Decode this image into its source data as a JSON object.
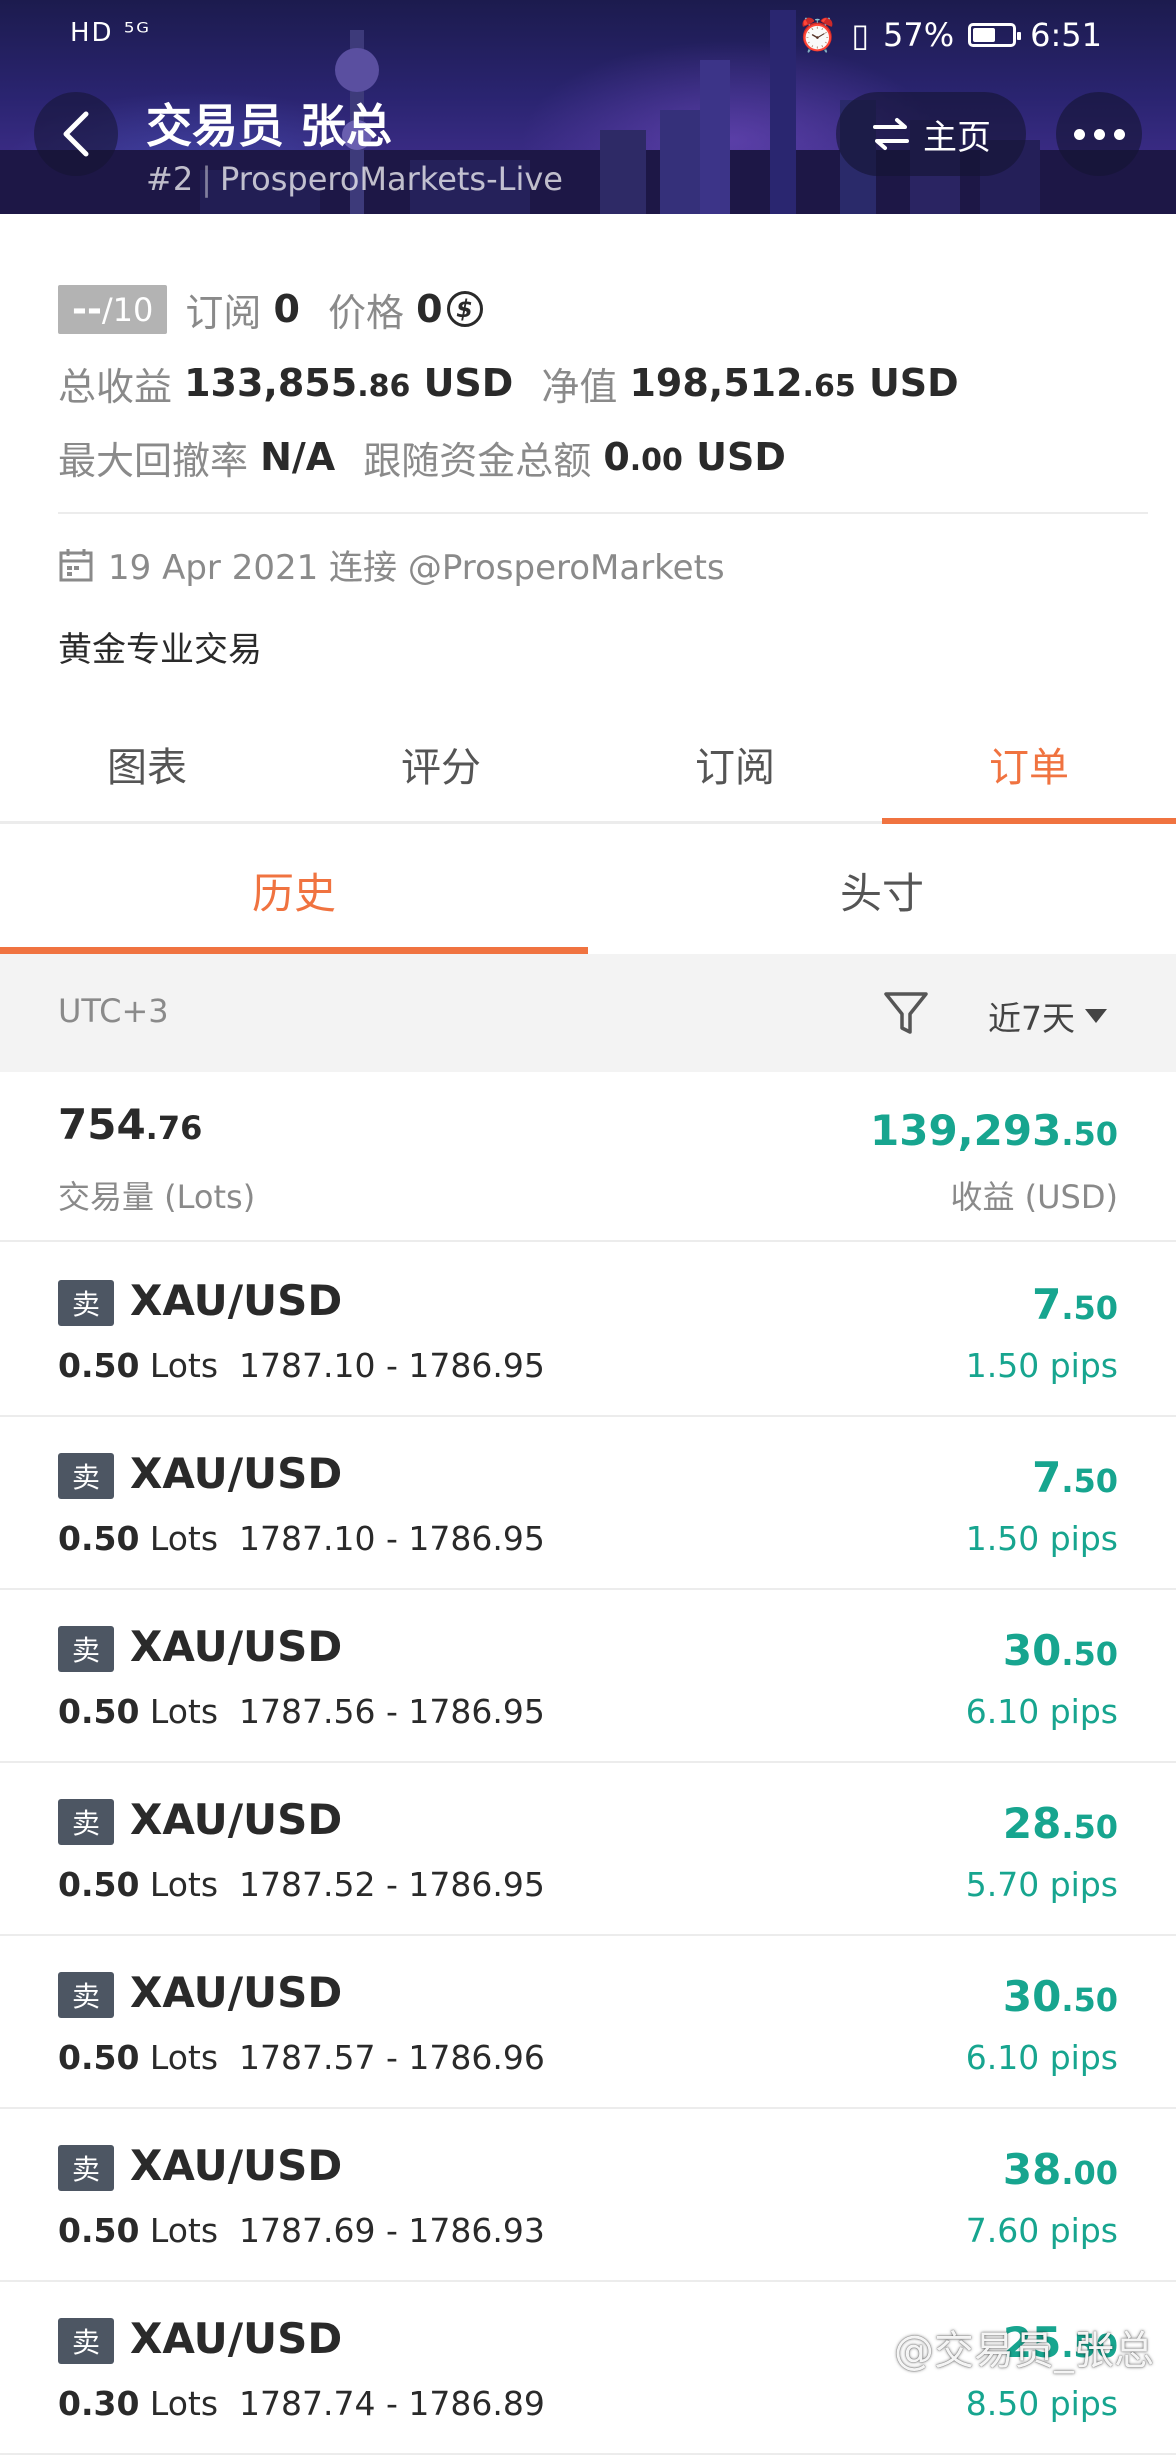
{
  "status_bar": {
    "left": "HD ⁵ᴳ",
    "battery": "57%",
    "battery_level": 0.57,
    "time": "6:51"
  },
  "header": {
    "title": "交易员  张总",
    "rank": "#2",
    "server": "ProsperoMarkets-Live",
    "home_label": "主页"
  },
  "stats": {
    "rating_value": "--",
    "rating_max": "/10",
    "subscribe_label": "订阅",
    "subscribe_value": "0",
    "price_label": "价格",
    "price_value": "0",
    "price_icon_glyph": "$",
    "total_profit_label": "总收益",
    "total_profit_int": "133,855",
    "total_profit_dec": ".86",
    "total_profit_unit": "USD",
    "equity_label": "净值",
    "equity_int": "198,512",
    "equity_dec": ".65",
    "equity_unit": "USD",
    "drawdown_label": "最大回撤率",
    "drawdown_value": "N/A",
    "follow_label": "跟随资金总额",
    "follow_int": "0",
    "follow_dec": ".00",
    "follow_unit": "USD"
  },
  "profile": {
    "joined": "19 Apr 2021 连接 @ProsperoMarkets",
    "description": "黄金专业交易"
  },
  "tabs": [
    "图表",
    "评分",
    "订阅",
    "订单"
  ],
  "active_tab": 3,
  "subtabs": [
    "历史",
    "头寸"
  ],
  "active_subtab": 0,
  "filter": {
    "timezone": "UTC+3",
    "period": "近7天"
  },
  "summary": {
    "volume_int": "754",
    "volume_dec": ".76",
    "volume_label": "交易量 (Lots)",
    "profit_int": "139,293",
    "profit_dec": ".50",
    "profit_label": "收益 (USD)"
  },
  "orders": [
    {
      "side": "卖",
      "symbol": "XAU/USD",
      "lots": "0.50",
      "lots_unit": "Lots",
      "prices": "1787.10 - 1786.95",
      "profit_int": "7",
      "profit_dec": ".50",
      "pips": "1.50 pips"
    },
    {
      "side": "卖",
      "symbol": "XAU/USD",
      "lots": "0.50",
      "lots_unit": "Lots",
      "prices": "1787.10 - 1786.95",
      "profit_int": "7",
      "profit_dec": ".50",
      "pips": "1.50 pips"
    },
    {
      "side": "卖",
      "symbol": "XAU/USD",
      "lots": "0.50",
      "lots_unit": "Lots",
      "prices": "1787.56 - 1786.95",
      "profit_int": "30",
      "profit_dec": ".50",
      "pips": "6.10 pips"
    },
    {
      "side": "卖",
      "symbol": "XAU/USD",
      "lots": "0.50",
      "lots_unit": "Lots",
      "prices": "1787.52 - 1786.95",
      "profit_int": "28",
      "profit_dec": ".50",
      "pips": "5.70 pips"
    },
    {
      "side": "卖",
      "symbol": "XAU/USD",
      "lots": "0.50",
      "lots_unit": "Lots",
      "prices": "1787.57 - 1786.96",
      "profit_int": "30",
      "profit_dec": ".50",
      "pips": "6.10 pips"
    },
    {
      "side": "卖",
      "symbol": "XAU/USD",
      "lots": "0.50",
      "lots_unit": "Lots",
      "prices": "1787.69 - 1786.93",
      "profit_int": "38",
      "profit_dec": ".00",
      "pips": "7.60 pips"
    },
    {
      "side": "卖",
      "symbol": "XAU/USD",
      "lots": "0.30",
      "lots_unit": "Lots",
      "prices": "1787.74 - 1786.89",
      "profit_int": "25",
      "profit_dec": ".50",
      "pips": "8.50 pips"
    }
  ],
  "watermark": "@交易员_张总",
  "colors": {
    "accent": "#f07340",
    "profit_green": "#17a58f",
    "sell_badge": "#4d5663",
    "banner": "#2a2470"
  }
}
